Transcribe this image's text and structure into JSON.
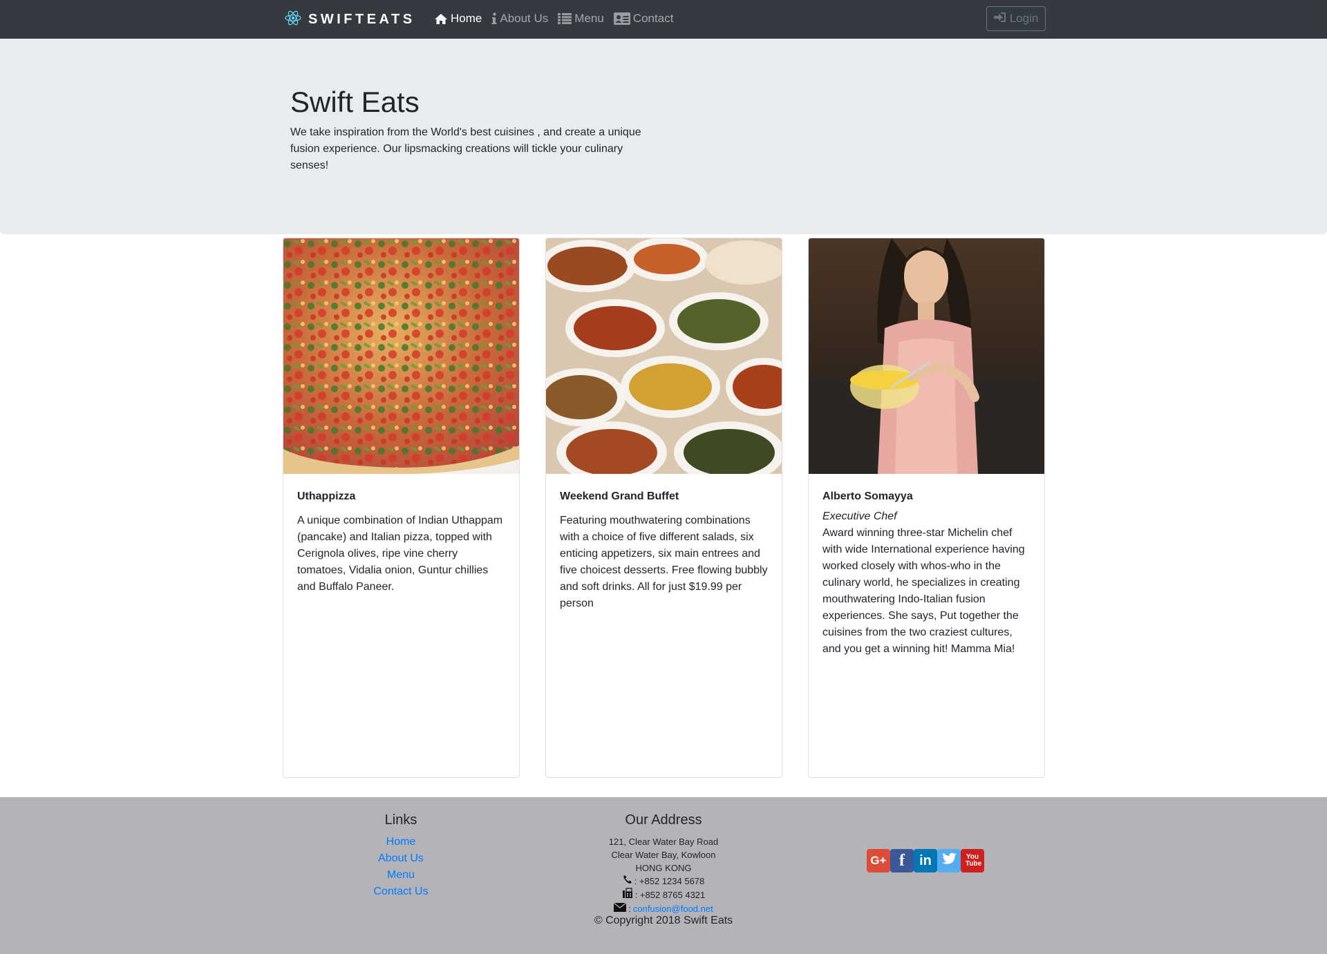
{
  "navbar": {
    "brand": "SWIFTEATS",
    "items": [
      {
        "label": "Home",
        "icon": "home-icon",
        "active": true
      },
      {
        "label": "About Us",
        "icon": "info-icon",
        "active": false
      },
      {
        "label": "Menu",
        "icon": "list-icon",
        "active": false
      },
      {
        "label": "Contact",
        "icon": "address-card-icon",
        "active": false
      }
    ],
    "login_label": "Login"
  },
  "jumbotron": {
    "title": "Swift Eats",
    "text": "We take inspiration from the World's best cuisines , and create a unique fusion experience. Our lipsmacking creations will tickle your culinary senses!"
  },
  "cards": [
    {
      "title": "Uthappizza",
      "text": "A unique combination of Indian Uthappam (pancake) and Italian pizza, topped with Cerignola olives, ripe vine cherry tomatoes, Vidalia onion, Guntur chillies and Buffalo Paneer."
    },
    {
      "title": "Weekend Grand Buffet",
      "text": "Featuring mouthwatering combinations with a choice of five different salads, six enticing appetizers, six main entrees and five choicest desserts. Free flowing bubbly and soft drinks. All for just $19.99 per person"
    },
    {
      "title": "Alberto Somayya",
      "subtitle": "Executive Chef",
      "text": "Award winning three-star Michelin chef with wide International experience having worked closely with whos-who in the culinary world, he specializes in creating mouthwatering Indo-Italian fusion experiences. She says, Put together the cuisines from the two craziest cultures, and you get a winning hit! Mamma Mia!"
    }
  ],
  "footer": {
    "links_heading": "Links",
    "links": [
      "Home",
      "About Us",
      "Menu",
      "Contact Us"
    ],
    "address_heading": "Our Address",
    "address_lines": [
      "121, Clear Water Bay Road",
      "Clear Water Bay, Kowloon",
      "HONG KONG"
    ],
    "phone": ": +852 1234 5678",
    "fax": ": +852 8765 4321",
    "email_prefix": ": ",
    "email": "confusion@food.net",
    "copyright": "© Copyright 2018 Swift Eats",
    "social": [
      {
        "icon": "google-plus-icon",
        "label": "G+",
        "color": "#dd4b39"
      },
      {
        "icon": "facebook-icon",
        "label": "f",
        "color": "#3b5998"
      },
      {
        "icon": "linkedin-icon",
        "label": "in",
        "color": "#0077b5"
      },
      {
        "icon": "twitter-icon",
        "label": "",
        "color": "#55acee"
      },
      {
        "icon": "youtube-icon",
        "label": "You Tube",
        "color": "#cd201f"
      }
    ]
  },
  "colors": {
    "navbar_bg": "#343a40",
    "jumbotron_bg": "#e9ecef",
    "footer_bg": "#b3b3b8",
    "link": "#007bff",
    "react_logo": "#61dafb"
  }
}
